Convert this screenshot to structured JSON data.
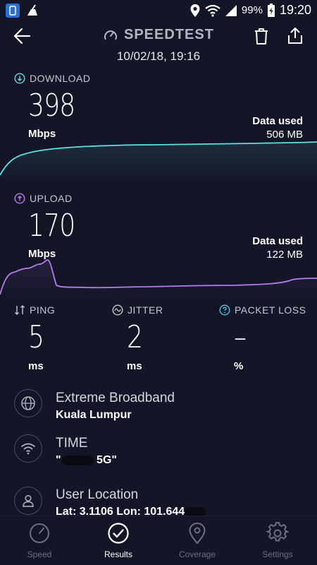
{
  "status": {
    "battery": "99%",
    "time": "19:20"
  },
  "header": {
    "title": "SPEEDTEST",
    "datetime": "10/02/18, 19:16"
  },
  "download": {
    "label": "DOWNLOAD",
    "value": "398",
    "unit": "Mbps",
    "used_label": "Data used",
    "used_value": "506 MB"
  },
  "upload": {
    "label": "UPLOAD",
    "value": "170",
    "unit": "Mbps",
    "used_label": "Data used",
    "used_value": "122 MB"
  },
  "ping": {
    "label": "PING",
    "value": "5",
    "unit": "ms"
  },
  "jitter": {
    "label": "JITTER",
    "value": "2",
    "unit": "ms"
  },
  "packet_loss": {
    "label": "PACKET LOSS",
    "value": "–",
    "unit": "%"
  },
  "server": {
    "title": "Extreme Broadband",
    "sub": "Kuala Lumpur"
  },
  "network": {
    "title": "TIME",
    "sub_prefix": "\"",
    "sub_suffix": " 5G\""
  },
  "location": {
    "title": "User Location",
    "sub": "Lat: 3.1106 Lon: 101.644"
  },
  "nav": {
    "speed": "Speed",
    "results": "Results",
    "coverage": "Coverage",
    "settings": "Settings"
  },
  "colors": {
    "background": "#141527",
    "download_accent": "#5ee0e0",
    "upload_accent": "#b57cf0",
    "ping_icon": "#c5c7d3",
    "packet_loss_icon": "#4bc3e6"
  }
}
